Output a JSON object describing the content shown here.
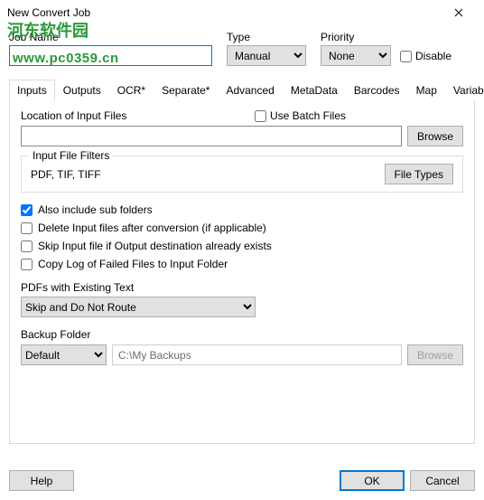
{
  "window": {
    "title": "New Convert Job"
  },
  "header": {
    "jobname_label": "Job Name",
    "jobname_value": "",
    "type_label": "Type",
    "type_value": "Manual",
    "priority_label": "Priority",
    "priority_value": "None",
    "disable_label": "Disable",
    "disable_checked": false
  },
  "watermark": {
    "line1": "河东软件园",
    "line2": "www.pc0359.cn"
  },
  "tabs": [
    "Inputs",
    "Outputs",
    "OCR*",
    "Separate*",
    "Advanced",
    "MetaData",
    "Barcodes",
    "Map",
    "Variables"
  ],
  "active_tab": 0,
  "inputs_tab": {
    "location_label": "Location of Input Files",
    "use_batch_label": "Use Batch Files",
    "use_batch_checked": false,
    "location_value": "",
    "browse_label": "Browse",
    "filters_group": "Input File Filters",
    "filters_text": "PDF, TIF, TIFF",
    "file_types_label": "File Types",
    "checks": [
      {
        "label": "Also include sub folders",
        "checked": true
      },
      {
        "label": "Delete Input files after conversion (if applicable)",
        "checked": false
      },
      {
        "label": "Skip Input file if Output destination already exists",
        "checked": false
      },
      {
        "label": "Copy Log of Failed Files to Input Folder",
        "checked": false
      }
    ],
    "pdfs_label": "PDFs with Existing Text",
    "pdfs_value": "Skip and Do Not Route",
    "backup_label": "Backup Folder",
    "backup_mode": "Default",
    "backup_path": "C:\\My Backups",
    "backup_browse": "Browse"
  },
  "footer": {
    "help": "Help",
    "ok": "OK",
    "cancel": "Cancel"
  }
}
